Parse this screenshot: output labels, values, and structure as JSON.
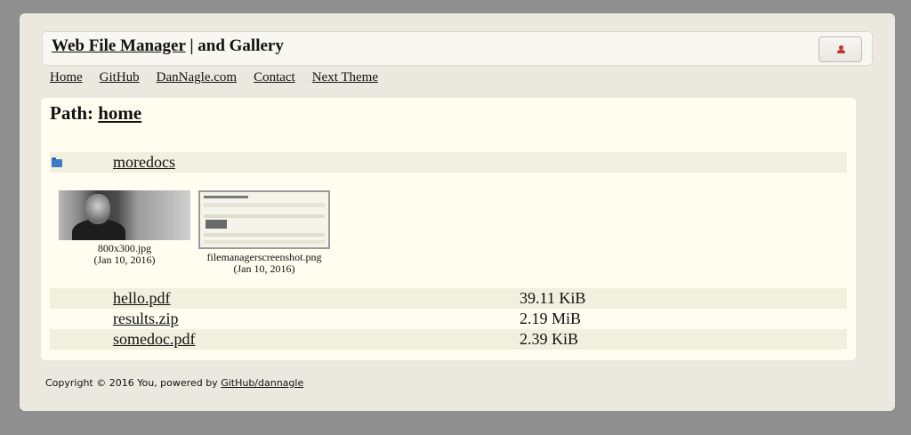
{
  "header": {
    "title_link": "Web File Manager",
    "title_rest": " | and Gallery",
    "user_icon": "user-icon"
  },
  "nav": {
    "items": [
      "Home",
      "GitHub",
      "DanNagle.com",
      "Contact",
      "Next Theme"
    ]
  },
  "path": {
    "label": "Path:",
    "current": "home"
  },
  "folders": [
    {
      "name": "moredocs",
      "icon": "folder-icon"
    }
  ],
  "gallery": [
    {
      "name": "800x300.jpg",
      "date": "(Jan 10, 2016)"
    },
    {
      "name": "filemanagerscreenshot.png",
      "date": "(Jan 10, 2016)"
    }
  ],
  "files": [
    {
      "name": "hello.pdf",
      "size": "39.11 KiB"
    },
    {
      "name": "results.zip",
      "size": "2.19 MiB"
    },
    {
      "name": "somedoc.pdf",
      "size": "2.39 KiB"
    }
  ],
  "footer": {
    "text": "Copyright © 2016 You, powered by ",
    "link": "GitHub/dannagle"
  }
}
